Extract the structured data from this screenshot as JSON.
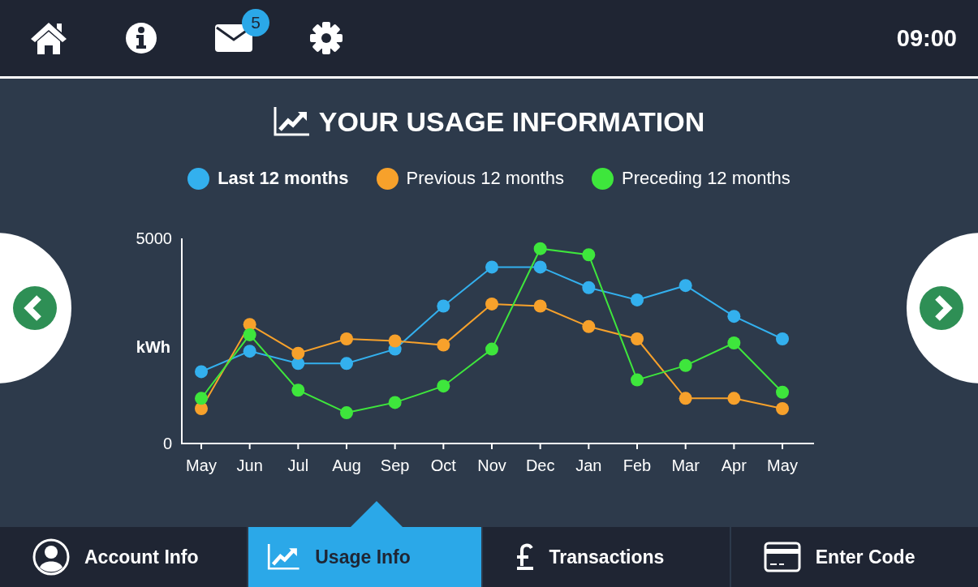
{
  "top_bar": {
    "message_badge": "5",
    "time": "09:00"
  },
  "title": "YOUR USAGE INFORMATION",
  "usage_chart": {
    "chart_data": {
      "type": "line",
      "ylabel": "kWh",
      "categories": [
        "May",
        "Jun",
        "Jul",
        "Aug",
        "Sep",
        "Oct",
        "Nov",
        "Dec",
        "Jan",
        "Feb",
        "Mar",
        "Apr",
        "May"
      ],
      "ylim": [
        0,
        5000
      ],
      "yticks": [
        0,
        5000
      ],
      "series": [
        {
          "name": "Last 12 months",
          "color": "#33b0ee",
          "marker": "circle",
          "values": [
            1750,
            2250,
            1950,
            1950,
            2300,
            3350,
            4300,
            4300,
            3800,
            3500,
            3850,
            3100,
            2550
          ]
        },
        {
          "name": "Previous 12 months",
          "color": "#f7a12b",
          "marker": "circle",
          "values": [
            850,
            2900,
            2200,
            2550,
            2500,
            2400,
            3400,
            3350,
            2850,
            2550,
            1100,
            1100,
            850
          ]
        },
        {
          "name": "Preceding 12 months",
          "color": "#3ee63c",
          "marker": "circle",
          "values": [
            1100,
            2650,
            1300,
            750,
            1000,
            1400,
            2300,
            4750,
            4600,
            1550,
            1900,
            2450,
            1250
          ]
        }
      ]
    },
    "legend": [
      {
        "selected": true
      },
      {
        "selected": false
      },
      {
        "selected": false
      }
    ]
  },
  "bottom_tabs": [
    {
      "label": "Account Info",
      "kind": "person",
      "selected": false
    },
    {
      "label": "Usage Info",
      "kind": "chart",
      "selected": true
    },
    {
      "label": "Transactions",
      "kind": "pound",
      "selected": false
    },
    {
      "label": "Enter Code",
      "kind": "card",
      "selected": false
    }
  ]
}
